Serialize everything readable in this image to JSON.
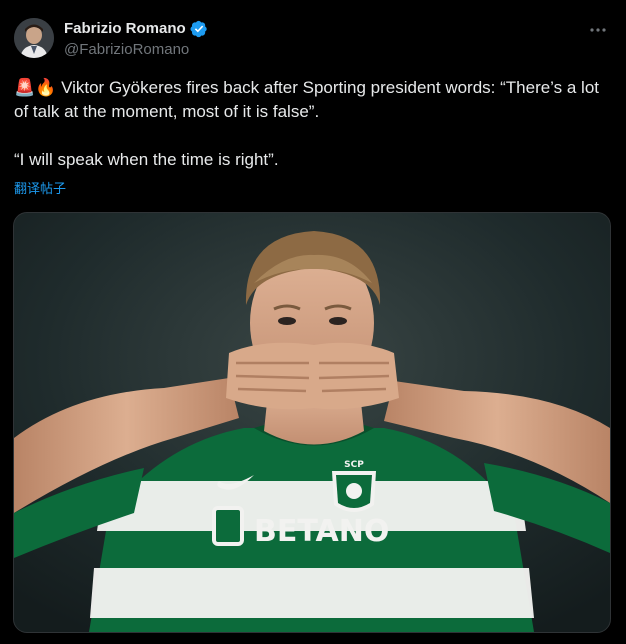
{
  "author": {
    "display_name": "Fabrizio Romano",
    "handle": "@FabrizioRomano",
    "verified_icon": "verified-badge-icon",
    "accent_color": "#1d9bf0"
  },
  "tweet": {
    "line1_emojis": "🚨🔥",
    "line1_text": " Viktor Gyökeres fires back after Sporting president words: “There’s a lot of talk at the moment, most of it is false”.",
    "line2_text": "“I will speak when the time is right”.",
    "translate_label": "翻译帖子"
  },
  "media": {
    "jersey_sponsor": "BETANO",
    "crest_text": "SCP"
  },
  "colors": {
    "background": "#000000",
    "text_primary": "#e7e9ea",
    "text_secondary": "#71767b",
    "link": "#1d9bf0",
    "jersey_green": "#0c6b3b",
    "jersey_white": "#f2f2f0"
  }
}
